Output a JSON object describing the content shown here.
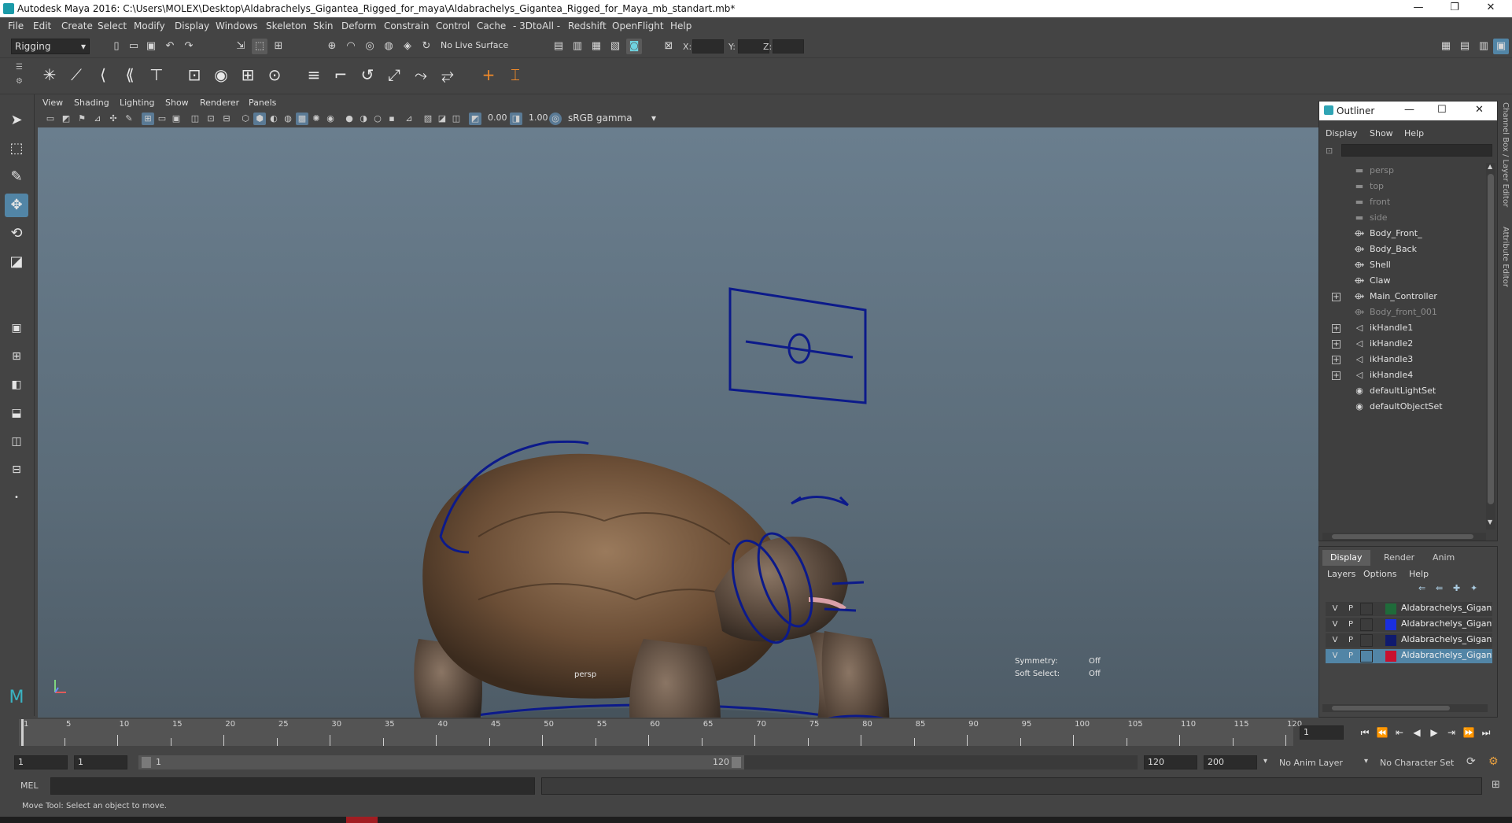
{
  "window": {
    "title": "Autodesk Maya 2016: C:\\Users\\MOLEX\\Desktop\\Aldabrachelys_Gigantea_Rigged_for_maya\\Aldabrachelys_Gigantea_Rigged_for_Maya_mb_standart.mb*",
    "minimize": "—",
    "restore": "❐",
    "close": "✕"
  },
  "menu": [
    "File",
    "Edit",
    "Create",
    "Select",
    "Modify",
    "Display",
    "Windows",
    "Skeleton",
    "Skin",
    "Deform",
    "Constrain",
    "Control",
    "Cache",
    "- 3DtoAll -",
    "Redshift",
    "OpenFlight",
    "Help"
  ],
  "statusline": {
    "mode": "Rigging",
    "live_surface": "No Live Surface",
    "x_label": "X:",
    "y_label": "Y:",
    "z_label": "Z:"
  },
  "panel": {
    "menu": [
      "View",
      "Shading",
      "Lighting",
      "Show",
      "Renderer",
      "Panels"
    ],
    "exposure": "0.00",
    "gamma": "1.00",
    "colorspace": "sRGB gamma",
    "camera_label": "persp",
    "symmetry_label": "Symmetry:",
    "symmetry_value": "Off",
    "soft_select_label": "Soft Select:",
    "soft_select_value": "Off"
  },
  "outliner": {
    "title": "Outliner",
    "menu": [
      "Display",
      "Show",
      "Help"
    ],
    "items": [
      {
        "label": "persp",
        "icon": "camera-icon",
        "dim": true,
        "expandable": false
      },
      {
        "label": "top",
        "icon": "camera-icon",
        "dim": true,
        "expandable": false
      },
      {
        "label": "front",
        "icon": "camera-icon",
        "dim": true,
        "expandable": false
      },
      {
        "label": "side",
        "icon": "camera-icon",
        "dim": true,
        "expandable": false
      },
      {
        "label": "Body_Front_",
        "icon": "mesh-icon",
        "dim": false,
        "expandable": false
      },
      {
        "label": "Body_Back",
        "icon": "mesh-icon",
        "dim": false,
        "expandable": false
      },
      {
        "label": "Shell",
        "icon": "mesh-icon",
        "dim": false,
        "expandable": false
      },
      {
        "label": "Claw",
        "icon": "mesh-icon",
        "dim": false,
        "expandable": false
      },
      {
        "label": "Main_Controller",
        "icon": "mesh-icon",
        "dim": false,
        "expandable": true
      },
      {
        "label": "Body_front_001",
        "icon": "mesh-icon",
        "dim": true,
        "expandable": false
      },
      {
        "label": "ikHandle1",
        "icon": "ik-handle-icon",
        "dim": false,
        "expandable": true
      },
      {
        "label": "ikHandle2",
        "icon": "ik-handle-icon",
        "dim": false,
        "expandable": true
      },
      {
        "label": "ikHandle3",
        "icon": "ik-handle-icon",
        "dim": false,
        "expandable": true
      },
      {
        "label": "ikHandle4",
        "icon": "ik-handle-icon",
        "dim": false,
        "expandable": true
      },
      {
        "label": "defaultLightSet",
        "icon": "set-icon",
        "dim": false,
        "expandable": false
      },
      {
        "label": "defaultObjectSet",
        "icon": "set-icon",
        "dim": false,
        "expandable": false
      }
    ]
  },
  "layers": {
    "tabs": [
      "Display",
      "Render",
      "Anim"
    ],
    "menu": [
      "Layers",
      "Options",
      "Help"
    ],
    "rows": [
      {
        "v": "V",
        "p": "P",
        "name": "Aldabrachelys_Gigantea",
        "color": "#1f6b3a",
        "selected": false
      },
      {
        "v": "V",
        "p": "P",
        "name": "Aldabrachelys_Gigantea",
        "color": "#1a2fe0",
        "selected": false
      },
      {
        "v": "V",
        "p": "P",
        "name": "Aldabrachelys_Gigantea",
        "color": "#0f1a6e",
        "selected": false
      },
      {
        "v": "V",
        "p": "P",
        "name": "Aldabrachelys_Gigantea",
        "color": "#c8102e",
        "selected": true
      }
    ]
  },
  "sidetabs": [
    "Channel Box / Layer Editor",
    "Attribute Editor"
  ],
  "timeline": {
    "ticks": [
      1,
      5,
      10,
      15,
      20,
      25,
      30,
      35,
      40,
      45,
      50,
      55,
      60,
      65,
      70,
      75,
      80,
      85,
      90,
      95,
      100,
      105,
      110,
      115,
      120
    ],
    "current_frame": "1"
  },
  "range": {
    "start": "1",
    "playback_start": "1",
    "slider_start": "1",
    "slider_end": "120",
    "playback_end": "120",
    "end": "200",
    "anim_layer": "No Anim Layer",
    "character_set": "No Character Set"
  },
  "cmdline": {
    "lang": "MEL"
  },
  "helpline": "Move Tool: Select an object to move.",
  "colors": {
    "rig_curve": "#0c1a8a",
    "selection_blue": "#5285a6"
  }
}
